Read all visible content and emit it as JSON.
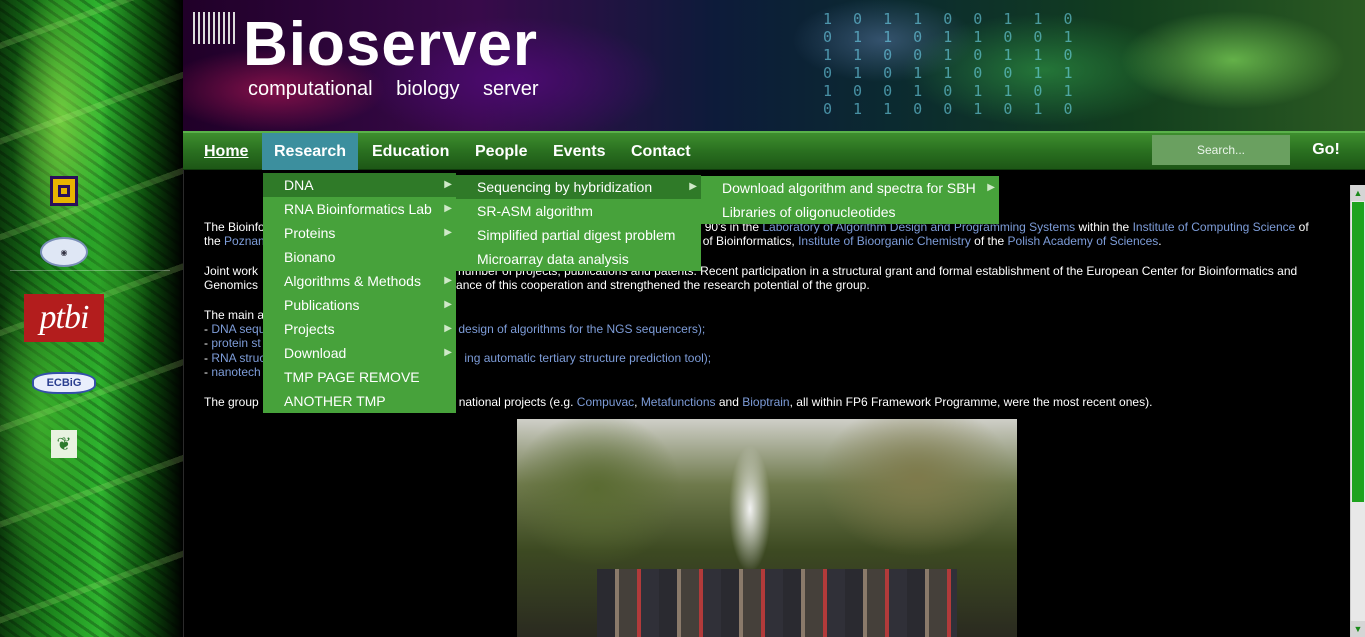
{
  "header": {
    "title": "Bioserver",
    "subtitle": "computational biology server"
  },
  "nav": {
    "items": [
      "Home",
      "Research",
      "Education",
      "People",
      "Events",
      "Contact"
    ],
    "active": "Research"
  },
  "search": {
    "placeholder": "Search...",
    "button_label": "Go!"
  },
  "research_menu": {
    "items": [
      {
        "label": "DNA",
        "has_submenu": true
      },
      {
        "label": "RNA Bioinformatics Lab",
        "has_submenu": true
      },
      {
        "label": "Proteins",
        "has_submenu": true
      },
      {
        "label": "Bionano",
        "has_submenu": false
      },
      {
        "label": "Algorithms & Methods",
        "has_submenu": true
      },
      {
        "label": "Publications",
        "has_submenu": true
      },
      {
        "label": "Projects",
        "has_submenu": true
      },
      {
        "label": "Download",
        "has_submenu": true
      },
      {
        "label": "TMP PAGE REMOVE",
        "has_submenu": false
      },
      {
        "label": "ANOTHER TMP",
        "has_submenu": false
      }
    ]
  },
  "dna_menu": {
    "items": [
      {
        "label": "Sequencing by hybridization",
        "has_submenu": true
      },
      {
        "label": "SR-ASM algorithm",
        "has_submenu": false
      },
      {
        "label": "Simplified partial digest problem",
        "has_submenu": false
      },
      {
        "label": "Microarray data analysis",
        "has_submenu": false
      }
    ]
  },
  "sbh_menu": {
    "items": [
      {
        "label": "Download algorithm and spectra for SBH",
        "has_submenu": true
      },
      {
        "label": "Libraries of oligonucleotides",
        "has_submenu": false
      }
    ]
  },
  "content": {
    "p1": {
      "t1": "The Bioinfo",
      "t2": "90's in the ",
      "link1": "Laboratory of Algorithm Design and Programming Systems",
      "t3": " within the ",
      "link2": "Institute of Computing Science",
      "t4": " of",
      "t5": "the ",
      "link3": "Poznan",
      "t6": "of Bioinformatics, ",
      "link4": "Institute of Bioorganic Chemistry",
      "t7": " of the ",
      "link5": "Polish Academy of Sciences",
      "t8": "."
    },
    "p2": {
      "t1": "Joint work",
      "t2": "d number of projects, publications and patents. Recent participation in a structural grant and formal establishment of the European Center for Bioinformatics and",
      "t3": "Genomics",
      "t4": "ance of this cooperation and strengthened the research potential of the group."
    },
    "p3": {
      "t1": "The main a",
      "l1a": "DNA sequ",
      "l1b": "design of algorithms for the NGS sequencers);",
      "l2a": "protein st",
      "l3a": "RNA struc",
      "l3b": "ing automatic tertiary structure prediction tool);",
      "l4a": "nanotech",
      "dash": "- "
    },
    "p4": {
      "t1": "The group",
      "t2": "national projects (e.g. ",
      "link1": "Compuvac",
      "sep": ", ",
      "link2": "Metafunctions",
      "t3": " and ",
      "link3": "Bioptrain",
      "t4": ", all within FP6 Framework Programme, were the most recent ones)."
    }
  },
  "logos": {
    "logo3_text": "ptbi",
    "logo4_text": "ECBiG"
  },
  "colors": {
    "nav_green": "#2a7020",
    "menu_green": "#47a23b",
    "menu_highlight": "#2f7a28",
    "active_tab": "#3c8f9e",
    "link": "#7d9cd8"
  }
}
